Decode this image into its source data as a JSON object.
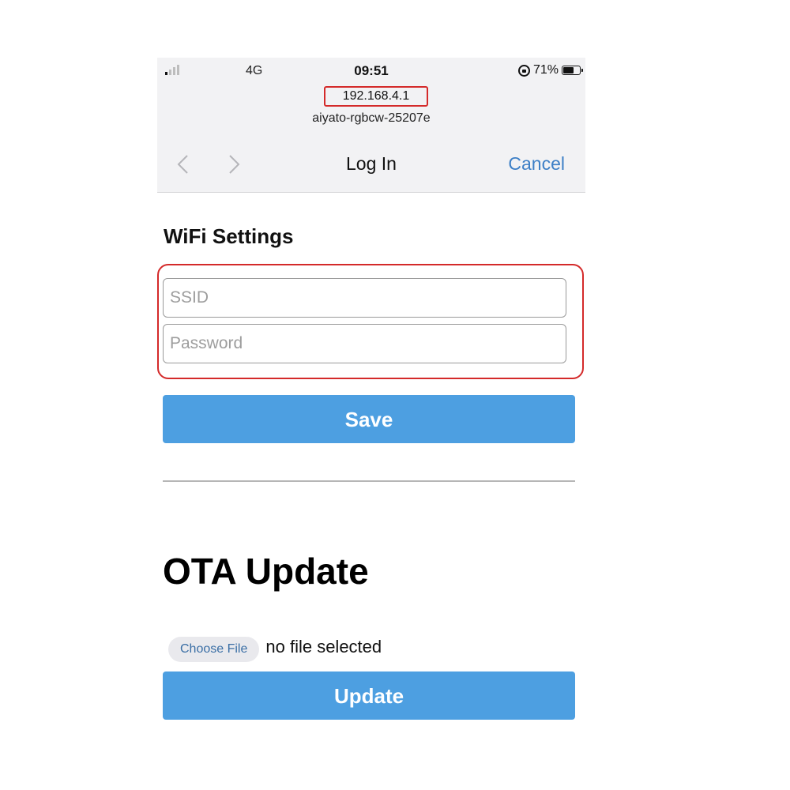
{
  "status_bar": {
    "network": "4G",
    "time": "09:51",
    "battery_percent": "71%",
    "battery_level": 0.71,
    "signal_bars_active": 1,
    "icons": [
      "signal-icon",
      "rotation-lock-icon",
      "battery-icon"
    ]
  },
  "browser": {
    "url": "192.168.4.1",
    "host": "aiyato-rgbcw-25207e",
    "title": "Log In",
    "cancel_label": "Cancel",
    "icons": [
      "back-chevron-icon",
      "forward-chevron-icon"
    ]
  },
  "wifi": {
    "heading": "WiFi Settings",
    "ssid_placeholder": "SSID",
    "ssid_value": "",
    "password_placeholder": "Password",
    "password_value": "",
    "save_label": "Save"
  },
  "ota": {
    "heading": "OTA Update",
    "choose_file_label": "Choose File",
    "file_status": "no file selected",
    "update_label": "Update"
  },
  "colors": {
    "accent_button": "#4d9fe1",
    "link_blue": "#3d7fc6",
    "highlight_red": "#d42a2a",
    "header_bg": "#f2f2f4"
  }
}
